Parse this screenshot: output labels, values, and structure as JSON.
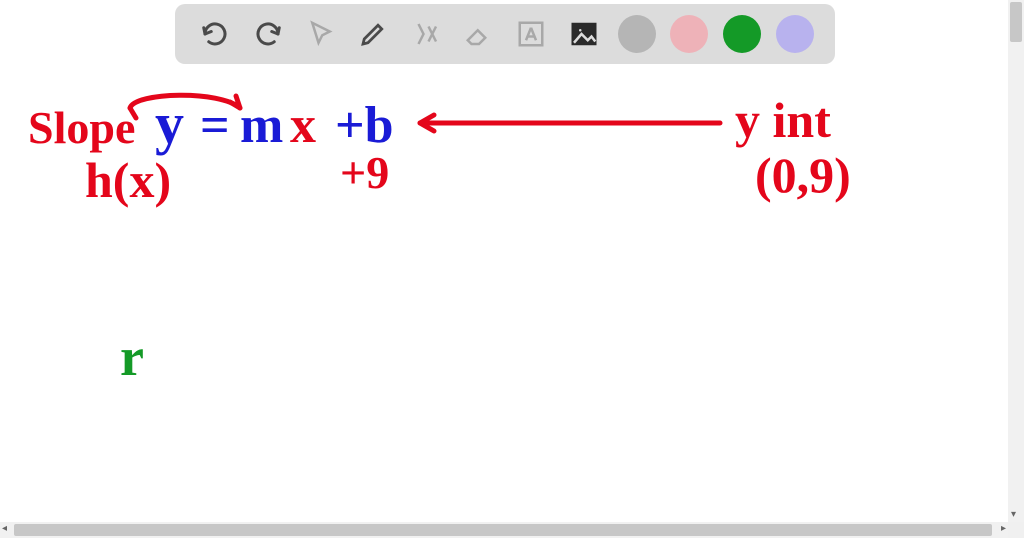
{
  "toolbar": {
    "tools": [
      "undo",
      "redo",
      "pointer",
      "pen",
      "math",
      "eraser",
      "text",
      "image"
    ],
    "colors": {
      "gray": "#b5b5b5",
      "pink": "#eeb2b8",
      "green": "#149a27",
      "lilac": "#b8b2ee"
    }
  },
  "writing": {
    "slope_label": "Slope",
    "eq_y": "y",
    "eq_eq": "=",
    "eq_m": "m",
    "eq_x": "x",
    "eq_plus_b": "+b",
    "hx": "h(x)",
    "plus9": "+9",
    "yint_label": "y int",
    "yint_point": "(0,9)",
    "green_mark": "r"
  }
}
